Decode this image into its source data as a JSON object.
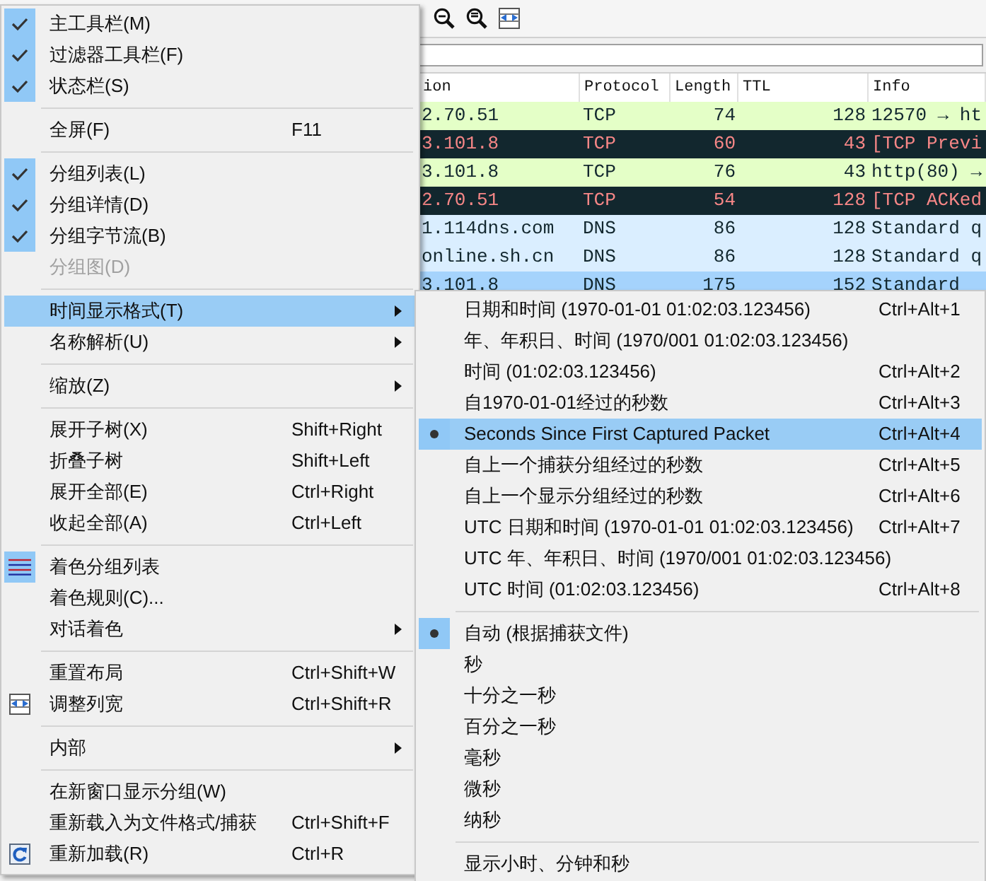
{
  "table": {
    "columns": [
      "ion",
      "Protocol",
      "Length",
      "TTL",
      "Info"
    ],
    "rows": [
      {
        "kind": "tcp",
        "selected": false,
        "cells": [
          "2.70.51",
          "TCP",
          "74",
          "128",
          "12570 → ht"
        ]
      },
      {
        "kind": "tcp_error",
        "selected": false,
        "cells": [
          "3.101.8",
          "TCP",
          "60",
          "43",
          "[TCP Previ"
        ]
      },
      {
        "kind": "tcp",
        "selected": false,
        "cells": [
          "3.101.8",
          "TCP",
          "76",
          "43",
          "http(80) →"
        ]
      },
      {
        "kind": "tcp_error",
        "selected": false,
        "cells": [
          "2.70.51",
          "TCP",
          "54",
          "128",
          "[TCP ACKed"
        ]
      },
      {
        "kind": "dns",
        "selected": false,
        "cells": [
          "1.114dns.com",
          "DNS",
          "86",
          "128",
          "Standard q"
        ]
      },
      {
        "kind": "dns",
        "selected": false,
        "cells": [
          "online.sh.cn",
          "DNS",
          "86",
          "128",
          "Standard q"
        ]
      },
      {
        "kind": "dns",
        "selected": true,
        "cells": [
          "3.101.8",
          "DNS",
          "175",
          "152",
          "Standard"
        ]
      }
    ]
  },
  "view_menu": {
    "groups": [
      [
        {
          "kind": "check",
          "label": "主工具栏(M)",
          "checked": true,
          "highlighted": false
        },
        {
          "kind": "check",
          "label": "过滤器工具栏(F)",
          "checked": true,
          "highlighted": false
        },
        {
          "kind": "check",
          "label": "状态栏(S)",
          "checked": true,
          "highlighted": false
        }
      ],
      [
        {
          "kind": "plain",
          "label": "全屏(F)",
          "shortcut": "F11",
          "highlighted": false
        }
      ],
      [
        {
          "kind": "check",
          "label": "分组列表(L)",
          "checked": true,
          "disabled": false,
          "highlighted": false
        },
        {
          "kind": "check",
          "label": "分组详情(D)",
          "checked": true,
          "disabled": false,
          "highlighted": false
        },
        {
          "kind": "check",
          "label": "分组字节流(B)",
          "checked": true,
          "disabled": false,
          "highlighted": false
        },
        {
          "kind": "check",
          "label": "分组图(D)",
          "checked": false,
          "disabled": true,
          "highlighted": false
        }
      ],
      [
        {
          "kind": "plain",
          "label": "时间显示格式(T)",
          "submenu": true,
          "highlighted": true
        },
        {
          "kind": "plain",
          "label": "名称解析(U)",
          "submenu": true,
          "highlighted": false
        }
      ],
      [
        {
          "kind": "plain",
          "label": "缩放(Z)",
          "submenu": true,
          "highlighted": false
        }
      ],
      [
        {
          "kind": "plain",
          "label": "展开子树(X)",
          "shortcut": "Shift+Right",
          "highlighted": false
        },
        {
          "kind": "plain",
          "label": "折叠子树",
          "shortcut": "Shift+Left",
          "highlighted": false
        },
        {
          "kind": "plain",
          "label": "展开全部(E)",
          "shortcut": "Ctrl+Right",
          "highlighted": false
        },
        {
          "kind": "plain",
          "label": "收起全部(A)",
          "shortcut": "Ctrl+Left",
          "highlighted": false
        }
      ],
      [
        {
          "kind": "colorize",
          "label": "着色分组列表",
          "checked": true,
          "highlighted": false
        },
        {
          "kind": "plain",
          "label": "着色规则(C)...",
          "highlighted": false
        },
        {
          "kind": "plain",
          "label": "对话着色",
          "submenu": true,
          "highlighted": false
        }
      ],
      [
        {
          "kind": "plain",
          "label": "重置布局",
          "shortcut": "Ctrl+Shift+W",
          "highlighted": false
        },
        {
          "kind": "resize",
          "label": "调整列宽",
          "shortcut": "Ctrl+Shift+R",
          "highlighted": false
        }
      ],
      [
        {
          "kind": "plain",
          "label": "内部",
          "submenu": true,
          "highlighted": false
        }
      ],
      [
        {
          "kind": "plain",
          "label": "在新窗口显示分组(W)",
          "highlighted": false
        },
        {
          "kind": "plain",
          "label": "重新载入为文件格式/捕获",
          "shortcut": "Ctrl+Shift+F",
          "highlighted": false
        },
        {
          "kind": "reload",
          "label": "重新加载(R)",
          "shortcut": "Ctrl+R",
          "highlighted": false
        }
      ]
    ]
  },
  "time_menu": {
    "groups": [
      [
        {
          "kind": "radio",
          "label": "日期和时间 (1970-01-01 01:02:03.123456)",
          "shortcut": "Ctrl+Alt+1",
          "checked": false,
          "highlighted": false
        },
        {
          "kind": "radio",
          "label": "年、年积日、时间 (1970/001 01:02:03.123456)",
          "checked": false,
          "highlighted": false
        },
        {
          "kind": "radio",
          "label": "时间 (01:02:03.123456)",
          "shortcut": "Ctrl+Alt+2",
          "checked": false,
          "highlighted": false
        },
        {
          "kind": "radio",
          "label": "自1970-01-01经过的秒数",
          "shortcut": "Ctrl+Alt+3",
          "checked": false,
          "highlighted": false
        },
        {
          "kind": "radio",
          "label": "Seconds Since First Captured Packet",
          "shortcut": "Ctrl+Alt+4",
          "checked": true,
          "highlighted": true
        },
        {
          "kind": "radio",
          "label": "自上一个捕获分组经过的秒数",
          "shortcut": "Ctrl+Alt+5",
          "checked": false,
          "highlighted": false
        },
        {
          "kind": "radio",
          "label": "自上一个显示分组经过的秒数",
          "shortcut": "Ctrl+Alt+6",
          "checked": false,
          "highlighted": false
        },
        {
          "kind": "radio",
          "label": "UTC 日期和时间 (1970-01-01 01:02:03.123456)",
          "shortcut": "Ctrl+Alt+7",
          "checked": false,
          "highlighted": false
        },
        {
          "kind": "radio",
          "label": "UTC 年、年积日、时间 (1970/001 01:02:03.123456)",
          "checked": false,
          "highlighted": false
        },
        {
          "kind": "radio",
          "label": "UTC 时间 (01:02:03.123456)",
          "shortcut": "Ctrl+Alt+8",
          "checked": false,
          "highlighted": false
        }
      ],
      [
        {
          "kind": "radio",
          "label": "自动 (根据捕获文件)",
          "checked": true,
          "highlighted": false
        },
        {
          "kind": "radio",
          "label": "秒",
          "checked": false,
          "highlighted": false
        },
        {
          "kind": "radio",
          "label": "十分之一秒",
          "checked": false,
          "highlighted": false
        },
        {
          "kind": "radio",
          "label": "百分之一秒",
          "checked": false,
          "highlighted": false
        },
        {
          "kind": "radio",
          "label": "毫秒",
          "checked": false,
          "highlighted": false
        },
        {
          "kind": "radio",
          "label": "微秒",
          "checked": false,
          "highlighted": false
        },
        {
          "kind": "radio",
          "label": "纳秒",
          "checked": false,
          "highlighted": false
        }
      ],
      [
        {
          "kind": "check",
          "label": "显示小时、分钟和秒",
          "checked": false,
          "highlighted": false
        }
      ]
    ]
  }
}
